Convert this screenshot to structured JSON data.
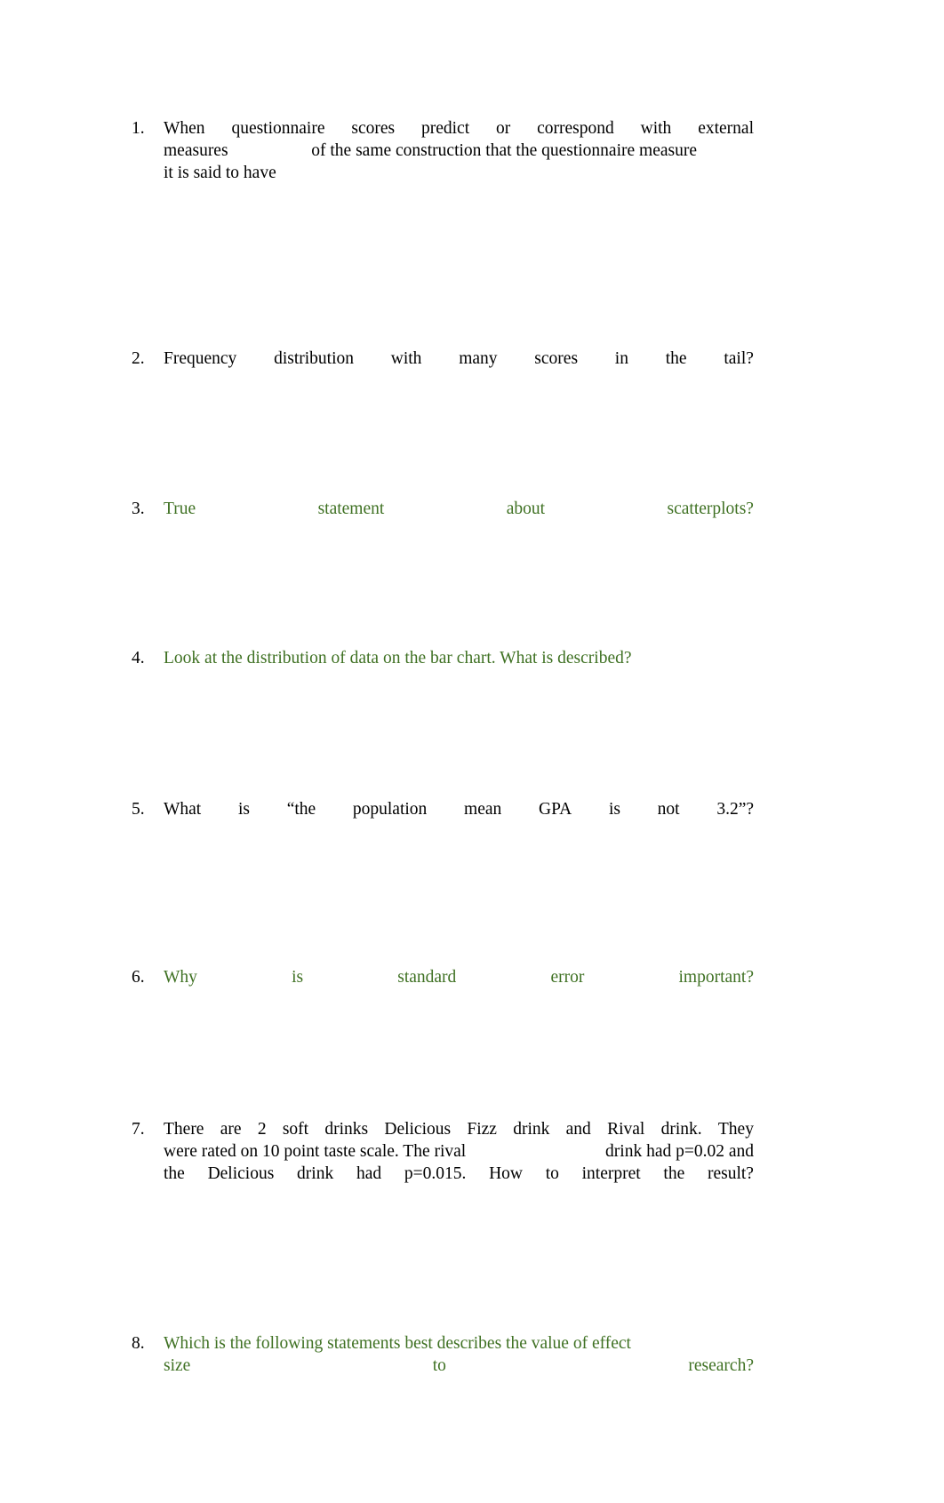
{
  "document": {
    "title": "Statistics Quiz Questions",
    "colors": {
      "text_black": "#000000",
      "text_green": "#3f7123",
      "page_background": "#ffffff"
    }
  },
  "questions": [
    {
      "number": "1.",
      "color": "black",
      "lines": [
        {
          "type": "justified",
          "words": [
            "When",
            "questionnaire",
            "scores",
            "predict",
            "or",
            "correspond",
            "with",
            "external"
          ]
        },
        {
          "type": "justified_partial",
          "words": [
            "measures",
            "of the same construction that the questionnaire measure"
          ]
        },
        {
          "type": "plain",
          "text": "it is said to have"
        }
      ]
    },
    {
      "number": "2.",
      "color": "black",
      "lines": [
        {
          "type": "justified",
          "words": [
            "Frequency",
            "distribution",
            "with",
            "many",
            "scores",
            "in",
            "the",
            "tail?"
          ]
        }
      ]
    },
    {
      "number": "3.",
      "color": "green",
      "lines": [
        {
          "type": "justified",
          "words": [
            "True",
            "statement",
            "about",
            "scatterplots?"
          ]
        }
      ]
    },
    {
      "number": "4.",
      "color": "green",
      "lines": [
        {
          "type": "plain",
          "text": "Look at the distribution of data on the bar chart. What is described?"
        }
      ]
    },
    {
      "number": "5.",
      "color": "black",
      "lines": [
        {
          "type": "justified",
          "words": [
            "What",
            "is",
            "“the",
            "population",
            "mean",
            "GPA",
            "is",
            "not",
            "3.2”?"
          ]
        }
      ]
    },
    {
      "number": "6.",
      "color": "green",
      "lines": [
        {
          "type": "justified",
          "words": [
            "Why",
            "is",
            "standard",
            "error",
            "important?"
          ]
        }
      ]
    },
    {
      "number": "7.",
      "color": "black",
      "lines": [
        {
          "type": "justified",
          "words": [
            "There",
            "are",
            "2",
            "soft",
            "drinks",
            "Delicious",
            "Fizz",
            "drink",
            "and",
            "Rival",
            "drink.",
            "They"
          ]
        },
        {
          "type": "justified_partial",
          "words": [
            "were rated on 10 point taste scale. The rival",
            "drink had p=0.02 and"
          ]
        },
        {
          "type": "justified",
          "words": [
            "the",
            "Delicious",
            "drink",
            "had",
            "p=0.015.",
            "How",
            "to",
            "interpret",
            "the",
            "result?"
          ]
        }
      ]
    },
    {
      "number": "8.",
      "color": "green",
      "lines": [
        {
          "type": "plain",
          "text": "Which is the following statements best describes the value of effect"
        },
        {
          "type": "justified",
          "words": [
            "size",
            "to",
            "research?"
          ]
        }
      ]
    }
  ]
}
